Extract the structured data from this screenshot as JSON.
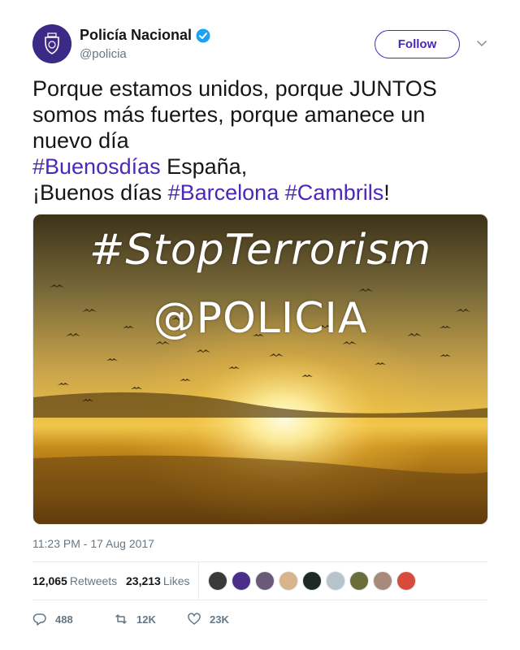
{
  "account": {
    "display_name": "Policía Nacional",
    "handle": "@policia",
    "verified": true,
    "follow_label": "Follow"
  },
  "tweet": {
    "line1": "Porque estamos unidos, porque JUNTOS",
    "line2": "somos más fuertes, porque amanece un",
    "line3": "nuevo día",
    "line4_hashtag": "#Buenosdías",
    "line4_text": " España,",
    "line5_text": "¡Buenos días ",
    "line5_hashtag1": "#Barcelona",
    "line5_space": " ",
    "line5_hashtag2": "#Cambrils",
    "line5_end": "!"
  },
  "media": {
    "overlay_line1": "#StopTerrorism",
    "overlay_line2": "@POLICIA"
  },
  "timestamp": "11:23 PM - 17 Aug 2017",
  "stats": {
    "retweets_count": "12,065",
    "retweets_label": "Retweets",
    "likes_count": "23,213",
    "likes_label": "Likes"
  },
  "actions": {
    "reply_count": "488",
    "retweet_count": "12K",
    "like_count": "23K"
  },
  "colors": {
    "accent": "#4a28b8",
    "verified": "#1da1f2",
    "muted": "#657786"
  }
}
